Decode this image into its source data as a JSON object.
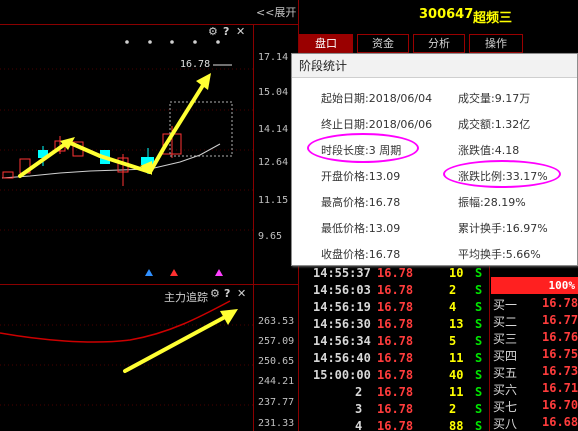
{
  "chart": {
    "expand_label": "<<展开",
    "y_axis_labels": [
      "17.14",
      "15.04",
      "14.14",
      "12.64",
      "11.15",
      "9.65"
    ],
    "sub_y_axis_labels": [
      "263.53",
      "257.09",
      "250.65",
      "244.21",
      "237.77",
      "231.33"
    ],
    "price_tag": "16.78",
    "indicator_title": "主力追踪",
    "icons": {
      "settings": "gear-icon",
      "help": "question-icon",
      "close": "close-icon"
    },
    "colors": {
      "candle_up": "#ff3333",
      "candle_down": "#00ffff",
      "arrow": "#ffff33",
      "indicator_line": "#cc0000"
    }
  },
  "header": {
    "code": "300647",
    "name": "超频三"
  },
  "tabs": [
    "盘口",
    "资金",
    "分析",
    "操作"
  ],
  "stats_dialog": {
    "title": "阶段统计",
    "fields": [
      {
        "key": "起始日期:",
        "value": "2018/06/04"
      },
      {
        "key": "成交量:",
        "value": "9.17万"
      },
      {
        "key": "终止日期:",
        "value": "2018/06/06"
      },
      {
        "key": "成交额:",
        "value": "1.32亿"
      },
      {
        "key": "时段长度:",
        "value": "3 周期"
      },
      {
        "key": "涨跌值:",
        "value": "4.18"
      },
      {
        "key": "开盘价格:",
        "value": "13.09"
      },
      {
        "key": "涨跌比例:",
        "value": "33.17%"
      },
      {
        "key": "最高价格:",
        "value": "16.78"
      },
      {
        "key": "振幅:",
        "value": "28.19%"
      },
      {
        "key": "最低价格:",
        "value": "13.09"
      },
      {
        "key": "累计换手:",
        "value": "16.97%"
      },
      {
        "key": "收盘价格:",
        "value": "16.78"
      },
      {
        "key": "平均换手:",
        "value": "5.66%"
      }
    ]
  },
  "trades": [
    {
      "time": "14:55:37",
      "price": "16.78",
      "vol": "10",
      "dir": "S"
    },
    {
      "time": "14:56:03",
      "price": "16.78",
      "vol": "2",
      "dir": "S"
    },
    {
      "time": "14:56:19",
      "price": "16.78",
      "vol": "4",
      "dir": "S"
    },
    {
      "time": "14:56:30",
      "price": "16.78",
      "vol": "13",
      "dir": "S"
    },
    {
      "time": "14:56:34",
      "price": "16.78",
      "vol": "5",
      "dir": "S"
    },
    {
      "time": "14:56:40",
      "price": "16.78",
      "vol": "11",
      "dir": "S"
    },
    {
      "time": "15:00:00",
      "price": "16.78",
      "vol": "40",
      "dir": "S"
    },
    {
      "time": "2",
      "price": "16.78",
      "vol": "11",
      "dir": "S"
    },
    {
      "time": "3",
      "price": "16.78",
      "vol": "2",
      "dir": "S"
    },
    {
      "time": "4",
      "price": "16.78",
      "vol": "88",
      "dir": "S"
    }
  ],
  "order_book": {
    "pct": "100%",
    "rows": [
      {
        "label": "买一",
        "price": "16.78"
      },
      {
        "label": "买二",
        "price": "16.77"
      },
      {
        "label": "买三",
        "price": "16.76"
      },
      {
        "label": "买四",
        "price": "16.75"
      },
      {
        "label": "买五",
        "price": "16.73"
      },
      {
        "label": "买六",
        "price": "16.71"
      },
      {
        "label": "买七",
        "price": "16.70"
      },
      {
        "label": "买八",
        "price": "16.68"
      }
    ]
  }
}
